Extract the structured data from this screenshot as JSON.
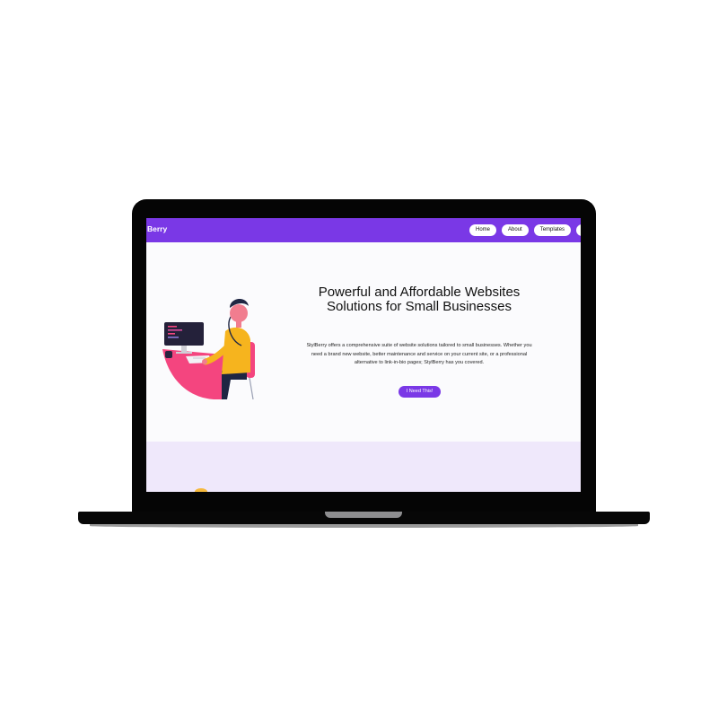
{
  "navbar": {
    "brand": "Berry",
    "links": [
      "Home",
      "About",
      "Templates",
      "C"
    ]
  },
  "hero": {
    "title": "Powerful and Affordable Websites Solutions for Small Businesses",
    "description": "StylBerry offers a comprehensive suite of website solutions tailored to small businesses. Whether you need a brand new website, better maintenance and service on your current site, or a professional alternative to link-in-bio pages; StylBerry has you covered.",
    "cta_label": "I Need This!"
  },
  "icons": {
    "illustration": "person-at-desk-illustration"
  },
  "colors": {
    "brand": "#7a38e6",
    "section_bg": "#efe8fb",
    "desk": "#f4457f",
    "shirt": "#f6b41e"
  }
}
